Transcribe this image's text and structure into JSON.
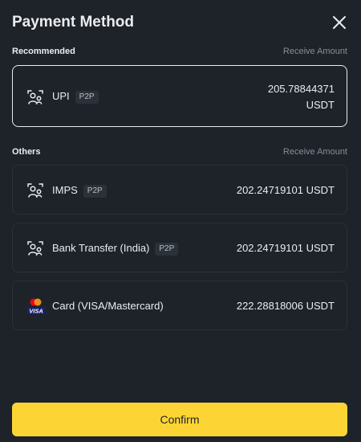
{
  "header": {
    "title": "Payment Method",
    "close_icon": "close-icon"
  },
  "recommended": {
    "label": "Recommended",
    "receive_label": "Receive Amount",
    "items": [
      {
        "name": "UPI",
        "badge": "P2P",
        "amount_value": "205.78844371",
        "amount_unit": "USDT",
        "icon": "p2p-user-icon",
        "selected": true
      }
    ]
  },
  "others": {
    "label": "Others",
    "receive_label": "Receive Amount",
    "items": [
      {
        "name": "IMPS",
        "badge": "P2P",
        "amount": "202.24719101 USDT",
        "icon": "p2p-user-icon"
      },
      {
        "name": "Bank Transfer (India)",
        "badge": "P2P",
        "amount": "202.24719101 USDT",
        "icon": "p2p-user-icon"
      },
      {
        "name": "Card (VISA/Mastercard)",
        "amount": "222.28818006 USDT",
        "icon": "visa-mastercard-icon",
        "icon_text": "VISA"
      }
    ]
  },
  "footer": {
    "confirm_label": "Confirm"
  },
  "colors": {
    "background": "#1e2329",
    "card_border": "#2b3139",
    "selected_border": "#eaecef",
    "accent_yellow": "#fcd535",
    "muted_text": "#848e9c",
    "mastercard_red": "#eb001b",
    "mastercard_orange": "#f79e1b",
    "visa_blue": "#1a1f71"
  }
}
